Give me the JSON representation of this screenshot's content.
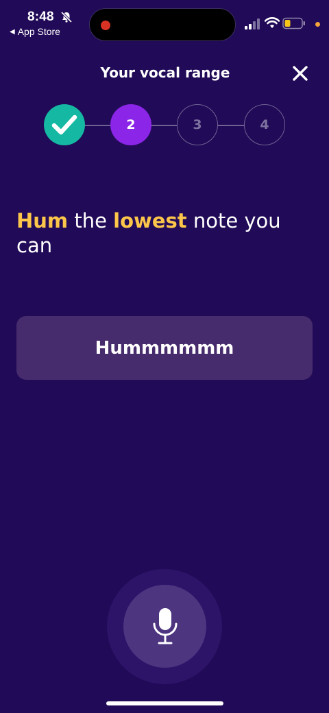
{
  "status_bar": {
    "time": "8:48",
    "back_label": "App Store"
  },
  "header": {
    "title": "Your vocal range"
  },
  "stepper": {
    "steps": [
      {
        "label": "",
        "state": "done"
      },
      {
        "label": "2",
        "state": "active"
      },
      {
        "label": "3",
        "state": "upcoming"
      },
      {
        "label": "4",
        "state": "upcoming"
      }
    ]
  },
  "prompt": {
    "part1": "Hum",
    "part2": " the ",
    "part3": "lowest",
    "part4": " note you can"
  },
  "hum_card": {
    "label": "Hummmmmm"
  },
  "colors": {
    "background": "#210a57",
    "highlight": "#fcc64a",
    "step_done": "#15b8a2",
    "step_active": "#8b25e8",
    "card": "#472c6d",
    "mic_button": "#4d3580"
  },
  "icons": [
    "bell-slash-icon",
    "back-arrow-icon",
    "signal-icon",
    "wifi-icon",
    "battery-icon",
    "close-icon",
    "checkmark-icon",
    "microphone-icon"
  ]
}
